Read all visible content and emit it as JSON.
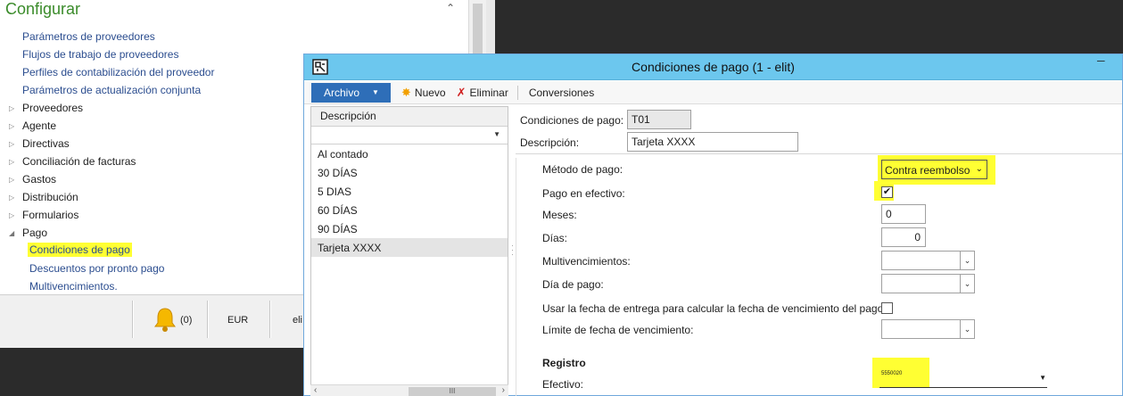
{
  "nav": {
    "header": "Configurar",
    "setup_links": [
      "Parámetros de proveedores",
      "Flujos de trabajo de proveedores",
      "Perfiles de contabilización del proveedor",
      "Parámetros de actualización conjunta"
    ],
    "groups": [
      "Proveedores",
      "Agente",
      "Directivas",
      "Conciliación de facturas",
      "Gastos",
      "Distribución",
      "Formularios"
    ],
    "expanded_group": "Pago",
    "pago_items": [
      "Condiciones de pago",
      "Descuentos por pronto pago",
      "Multivencimientos."
    ]
  },
  "status": {
    "notifications": "(0)",
    "currency": "EUR",
    "company": "eli"
  },
  "dialog": {
    "title": "Condiciones de pago (1 - elit)",
    "toolbar": {
      "archivo": "Archivo",
      "nuevo": "Nuevo",
      "eliminar": "Eliminar",
      "conversiones": "Conversiones"
    },
    "list": {
      "header": "Descripción",
      "rows": [
        "Al contado",
        "30 DÍAS",
        "5 DIAS",
        "60 DÍAS",
        "90 DÍAS",
        "Tarjeta XXXX"
      ],
      "selected_index": 5,
      "scroll_thumb": "III"
    },
    "form": {
      "condiciones_label": "Condiciones de pago:",
      "condiciones_value": "T01",
      "descripcion_label": "Descripción:",
      "descripcion_value": "Tarjeta XXXX",
      "metodo_label": "Método de pago:",
      "metodo_value": "Contra reembolso",
      "efectivo_pago_label": "Pago en efectivo:",
      "efectivo_pago_checked": true,
      "meses_label": "Meses:",
      "meses_value": "0",
      "dias_label": "Días:",
      "dias_value": "0",
      "multivenc_label": "Multivencimientos:",
      "multivenc_value": "",
      "dia_pago_label": "Día de pago:",
      "dia_pago_value": "",
      "usar_fecha_label": "Usar la fecha de entrega para calcular la fecha de vencimiento del pago:",
      "usar_fecha_checked": false,
      "limite_label": "Límite de fecha de vencimiento:",
      "limite_value": "",
      "registro_title": "Registro",
      "efectivo_label": "Efectivo:",
      "efectivo_value": "5550020"
    }
  },
  "colors": {
    "highlight": "#ffff33",
    "titlebar": "#6cc7ee",
    "archivo": "#2e6eb8",
    "nav_header": "#3a8b2a",
    "link": "#2b4d8f"
  }
}
